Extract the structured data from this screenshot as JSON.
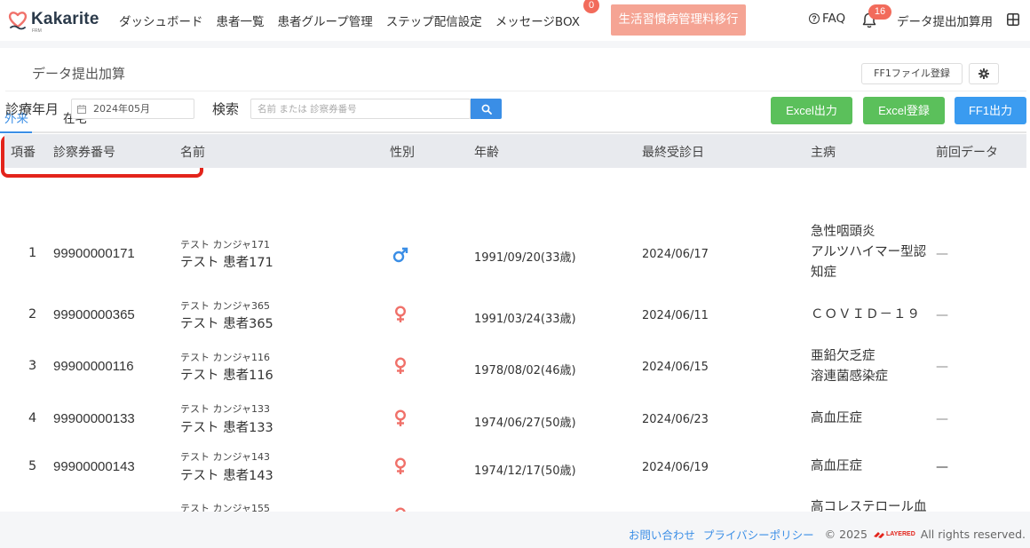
{
  "app": {
    "logo_text": "Kakarite",
    "logo_sub": "FRM"
  },
  "nav": {
    "items": [
      {
        "label": "ダッシュボード"
      },
      {
        "label": "患者一覧"
      },
      {
        "label": "患者グループ管理"
      },
      {
        "label": "ステップ配信設定"
      },
      {
        "label": "メッセージBOX"
      }
    ],
    "message_badge": "0",
    "highlight_label": "生活習慣病管理料移行",
    "faq_label": "FAQ",
    "notification_count": "16",
    "user_label": "データ提出加算用"
  },
  "page": {
    "title": "データ提出加算",
    "ff1_register_label": "FF1ファイル登録"
  },
  "tabs": [
    {
      "label": "外来",
      "active": true
    },
    {
      "label": "在宅",
      "active": false
    }
  ],
  "filters": {
    "month_label": "診療年月",
    "month_value": "2024年05月",
    "search_label": "検索",
    "search_placeholder": "名前 または 診察券番号"
  },
  "actions": {
    "excel_export": "Excel出力",
    "excel_import": "Excel登録",
    "ff1_export": "FF1出力"
  },
  "table": {
    "headers": {
      "index": "項番",
      "card_no": "診察券番号",
      "name": "名前",
      "sex": "性別",
      "age": "年齢",
      "last_visit": "最終受診日",
      "disease": "主病",
      "previous": "前回データ"
    },
    "rows": [
      {
        "index": "1",
        "card_no": "99900000171",
        "kana": "テスト カンジャ171",
        "name": "テスト 患者171",
        "sex": "male",
        "dob": "1991/09/20(33歳)",
        "last_visit": "2024/06/17",
        "disease_lines": [
          "急性咽頭炎",
          "アルツハイマー型認",
          "知症"
        ],
        "previous": "—"
      },
      {
        "index": "2",
        "card_no": "99900000365",
        "kana": "テスト カンジャ365",
        "name": "テスト 患者365",
        "sex": "female",
        "dob": "1991/03/24(33歳)",
        "last_visit": "2024/06/11",
        "disease_lines": [
          "ＣＯＶＩＤ－１９"
        ],
        "previous": "—"
      },
      {
        "index": "3",
        "card_no": "99900000116",
        "kana": "テスト カンジャ116",
        "name": "テスト 患者116",
        "sex": "female",
        "dob": "1978/08/02(46歳)",
        "last_visit": "2024/06/15",
        "disease_lines": [
          "亜鉛欠乏症",
          "溶連菌感染症"
        ],
        "previous": "—"
      },
      {
        "index": "4",
        "card_no": "99900000133",
        "kana": "テスト カンジャ133",
        "name": "テスト 患者133",
        "sex": "female",
        "dob": "1974/06/27(50歳)",
        "last_visit": "2024/06/23",
        "disease_lines": [
          "高血圧症"
        ],
        "previous": "—"
      },
      {
        "index": "5",
        "card_no": "99900000143",
        "kana": "テスト カンジャ143",
        "name": "テスト 患者143",
        "sex": "female",
        "dob": "1974/12/17(50歳)",
        "last_visit": "2024/06/19",
        "disease_lines": [
          "高血圧症"
        ],
        "previous": "—"
      },
      {
        "index": "",
        "card_no": "",
        "kana": "テスト カンジャ155",
        "name": "",
        "sex": "female",
        "dob": "",
        "last_visit": "",
        "disease_lines": [
          "高コレステロール血"
        ],
        "previous": ""
      }
    ]
  },
  "footer": {
    "contact_label": "お問い合わせ",
    "privacy_label": "プライバシーポリシー",
    "copyright": "© 2025",
    "brand": "LAYERED",
    "rights": "All rights reserved."
  },
  "colors": {
    "accent": "#3a8ee6",
    "male": "#3a8ee6",
    "female": "#f0716a",
    "highlight_border": "#e3241b",
    "nav_highlight": "#f5a494",
    "excel_button": "#5bc05b",
    "ff1_button": "#3a9bf0"
  }
}
